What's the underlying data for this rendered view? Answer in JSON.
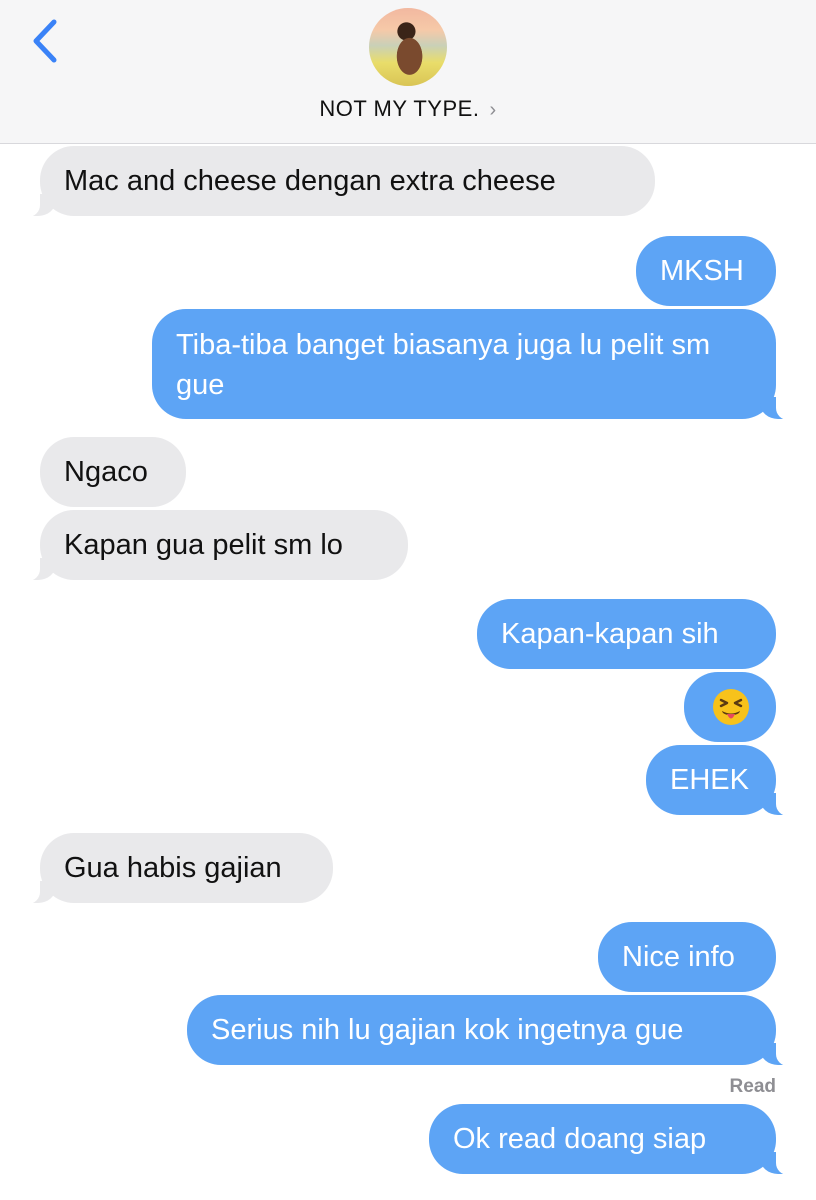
{
  "header": {
    "contact_name": "NOT MY TYPE.",
    "chevron": "›",
    "back_icon": "chevron-left-icon",
    "avatar": "contact-avatar-photo"
  },
  "messages": [
    {
      "from": "them",
      "text": "Mac and cheese dengan extra cheese"
    },
    {
      "from": "me",
      "text": "MKSH"
    },
    {
      "from": "me",
      "text": "Tiba-tiba banget biasanya juga lu pelit sm gue"
    },
    {
      "from": "them",
      "text": "Ngaco"
    },
    {
      "from": "them",
      "text": "Kapan gua pelit sm lo"
    },
    {
      "from": "me",
      "text": "Kapan-kapan sih"
    },
    {
      "from": "me",
      "emoji": "squinting-face-with-tongue"
    },
    {
      "from": "me",
      "text": "EHEK"
    },
    {
      "from": "them",
      "text": "Gua habis gajian"
    },
    {
      "from": "me",
      "text": "Nice info"
    },
    {
      "from": "me",
      "text": "Serius nih lu gajian kok ingetnya gue"
    },
    {
      "from": "me",
      "text": "Ok read doang siap"
    }
  ],
  "read_receipt": "Read",
  "colors": {
    "outgoing": "#5da4f5",
    "incoming": "#e9e9eb",
    "header_bg": "#f6f6f7",
    "accent": "#3a82f7"
  }
}
